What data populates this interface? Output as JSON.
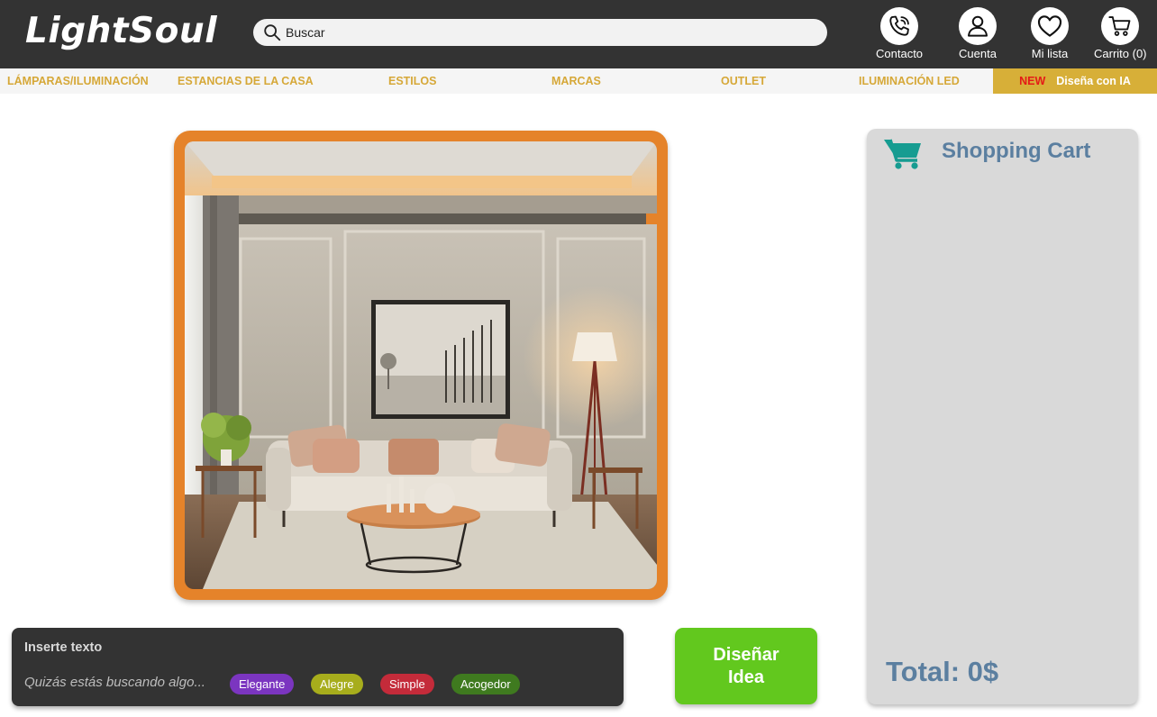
{
  "brand": {
    "logo": "LightSoul"
  },
  "search": {
    "placeholder": "Buscar",
    "icon": "search-icon"
  },
  "header_actions": [
    {
      "label": "Contacto",
      "icon": "phone-icon"
    },
    {
      "label": "Cuenta",
      "icon": "user-icon"
    },
    {
      "label": "Mi lista",
      "icon": "heart-icon"
    },
    {
      "label": "Carrito (0)",
      "icon": "cart-icon"
    }
  ],
  "nav": {
    "items": [
      "LÁMPARAS/ILUMINACIÓN",
      "ESTANCIAS DE LA CASA",
      "ESTILOS",
      "MARCAS",
      "OUTLET",
      "ILUMINACIÓN LED"
    ],
    "ia_badge": "NEW",
    "ia_label": "Diseña con IA"
  },
  "prompt": {
    "title": "Inserte texto",
    "placeholder": "Quizás estás buscando algo...",
    "tags": [
      {
        "label": "Elegante",
        "color": "#7b35c0"
      },
      {
        "label": "Alegre",
        "color": "#a7ad1c"
      },
      {
        "label": "Simple",
        "color": "#c42b3a"
      },
      {
        "label": "Acogedor",
        "color": "#3f7a1f"
      }
    ]
  },
  "design_button": {
    "label": "Diseñar Idea"
  },
  "cart": {
    "title": "Shopping Cart",
    "total": "Total: 0$"
  },
  "colors": {
    "header_bg": "#333333",
    "nav_text": "#d6a838",
    "frame": "#e5832a",
    "design_button": "#62c81e",
    "cart_accent": "#5b7fa0",
    "cart_icon": "#169c91"
  }
}
